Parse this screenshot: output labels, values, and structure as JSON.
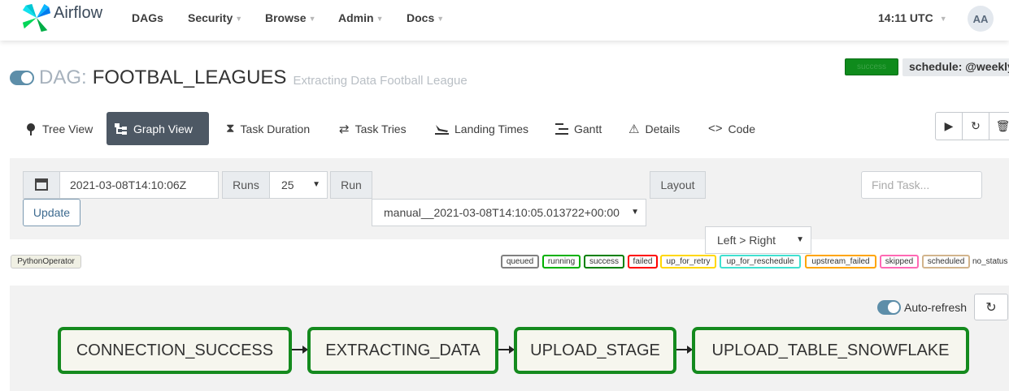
{
  "navbar": {
    "brand": "Airflow",
    "items": [
      "DAGs",
      "Security",
      "Browse",
      "Admin",
      "Docs"
    ],
    "time": "14:11 UTC",
    "avatar": "AA"
  },
  "dag": {
    "prefix": "DAG:",
    "id": "FOOTBAL_LEAGUES",
    "description": "Extracting Data Football League",
    "status_badge": "success",
    "schedule": "schedule: @weekly"
  },
  "tabs": [
    {
      "label": "Tree View",
      "icon": "tree-icon"
    },
    {
      "label": "Graph View",
      "icon": "graph-icon",
      "active": true
    },
    {
      "label": "Task Duration",
      "icon": "hourglass-icon"
    },
    {
      "label": "Task Tries",
      "icon": "retry-icon"
    },
    {
      "label": "Landing Times",
      "icon": "plane-landing-icon"
    },
    {
      "label": "Gantt",
      "icon": "gantt-icon"
    },
    {
      "label": "Details",
      "icon": "warning-triangle-icon"
    },
    {
      "label": "Code",
      "icon": "code-icon"
    }
  ],
  "actions": [
    "play-icon",
    "refresh-icon",
    "trash-icon"
  ],
  "filters": {
    "base_date": "2021-03-08T14:10:06Z",
    "runs_label": "Runs",
    "runs_value": "25",
    "run_label": "Run",
    "run_value": "manual__2021-03-08T14:10:05.013722+00:00",
    "layout_label": "Layout",
    "layout_value": "Left > Right",
    "find_placeholder": "Find Task...",
    "update_label": "Update"
  },
  "operator_legend": "PythonOperator",
  "states": [
    "queued",
    "running",
    "success",
    "failed",
    "up_for_retry",
    "up_for_reschedule",
    "upstream_failed",
    "skipped",
    "scheduled",
    "no_status"
  ],
  "state_colors": {
    "queued": "#808080",
    "running": "#00b000",
    "success": "#008000",
    "failed": "#ff0000",
    "up_for_retry": "#ffd700",
    "up_for_reschedule": "#40e0d0",
    "upstream_failed": "#ffa500",
    "skipped": "#ff69b4",
    "scheduled": "#d2b48c"
  },
  "graph": {
    "auto_refresh_label": "Auto-refresh",
    "nodes": [
      "CONNECTION_SUCCESS",
      "EXTRACTING_DATA",
      "UPLOAD_STAGE",
      "UPLOAD_TABLE_SNOWFLAKE"
    ],
    "node_state": "success"
  }
}
